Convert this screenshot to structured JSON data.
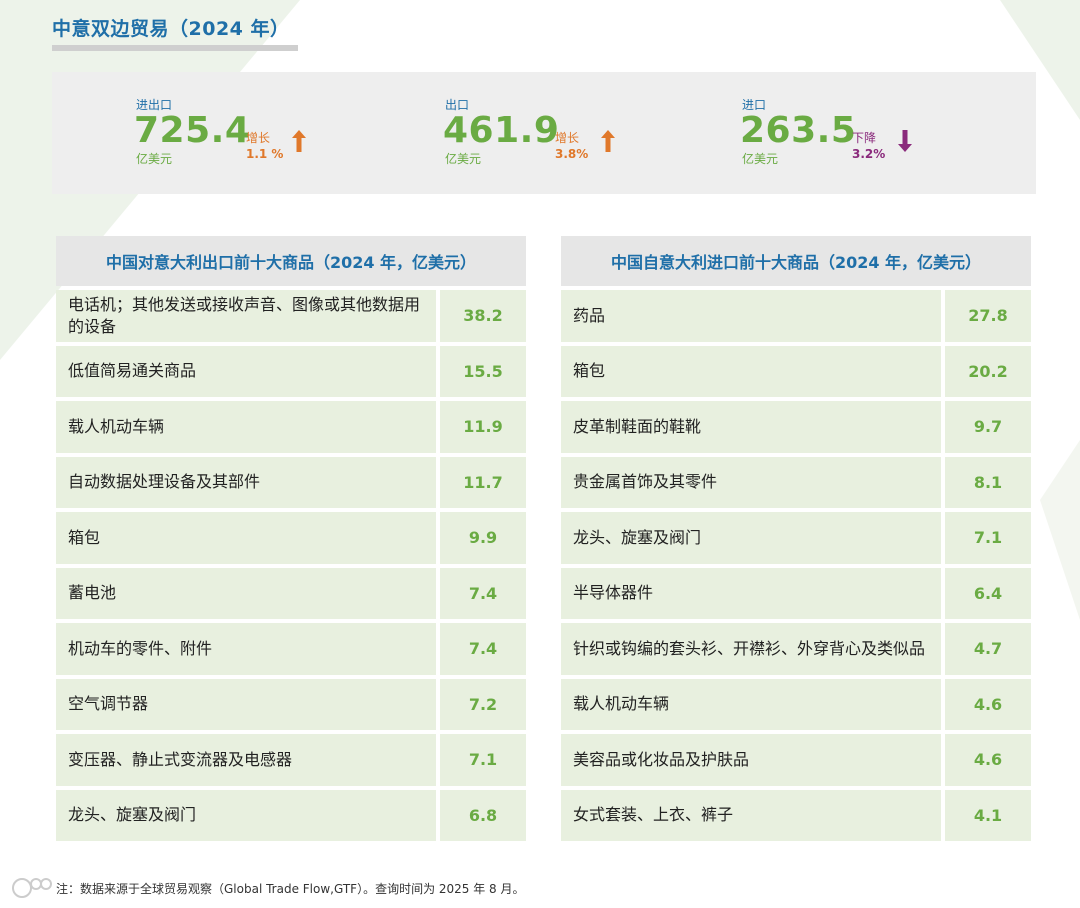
{
  "title": "中意双边贸易（2024 年）",
  "summary": [
    {
      "label": "进出口",
      "value": "725.4",
      "unit": "亿美元",
      "direction": "增长",
      "pct": "1.1 %",
      "trend": "up"
    },
    {
      "label": "出口",
      "value": "461.9",
      "unit": "亿美元",
      "direction": "增长",
      "pct": "3.8%",
      "trend": "up"
    },
    {
      "label": "进口",
      "value": "263.5",
      "unit": "亿美元",
      "direction": "下降",
      "pct": "3.2%",
      "trend": "down"
    }
  ],
  "export_table": {
    "title": "中国对意大利出口前十大商品（2024 年，亿美元）",
    "rows": [
      {
        "name": "电话机；其他发送或接收声音、图像或其他数据用的设备",
        "value": "38.2"
      },
      {
        "name": "低值简易通关商品",
        "value": "15.5"
      },
      {
        "name": "载人机动车辆",
        "value": "11.9"
      },
      {
        "name": "自动数据处理设备及其部件",
        "value": "11.7"
      },
      {
        "name": "箱包",
        "value": "9.9"
      },
      {
        "name": "蓄电池",
        "value": "7.4"
      },
      {
        "name": "机动车的零件、附件",
        "value": "7.4"
      },
      {
        "name": "空气调节器",
        "value": "7.2"
      },
      {
        "name": "变压器、静止式变流器及电感器",
        "value": "7.1"
      },
      {
        "name": "龙头、旋塞及阀门",
        "value": "6.8"
      }
    ]
  },
  "import_table": {
    "title": "中国自意大利进口前十大商品（2024 年，亿美元）",
    "rows": [
      {
        "name": "药品",
        "value": "27.8"
      },
      {
        "name": "箱包",
        "value": "20.2"
      },
      {
        "name": "皮革制鞋面的鞋靴",
        "value": "9.7"
      },
      {
        "name": "贵金属首饰及其零件",
        "value": "8.1"
      },
      {
        "name": "龙头、旋塞及阀门",
        "value": "7.1"
      },
      {
        "name": "半导体器件",
        "value": "6.4"
      },
      {
        "name": "针织或钩编的套头衫、开襟衫、外穿背心及类似品",
        "value": "4.7"
      },
      {
        "name": "载人机动车辆",
        "value": "4.6"
      },
      {
        "name": "美容品或化妆品及护肤品",
        "value": "4.6"
      },
      {
        "name": "女式套装、上衣、裤子",
        "value": "4.1"
      }
    ]
  },
  "footnote": "注：数据来源于全球贸易观察（Global Trade Flow,GTF）。查询时间为 2025 年 8 月。",
  "colors": {
    "title_blue": "#1f6fa8",
    "value_green": "#6aab43",
    "up_orange": "#e0782a",
    "down_purple": "#8a2a7c"
  },
  "icons": {
    "up": "arrow-up-icon",
    "down": "arrow-down-icon"
  }
}
